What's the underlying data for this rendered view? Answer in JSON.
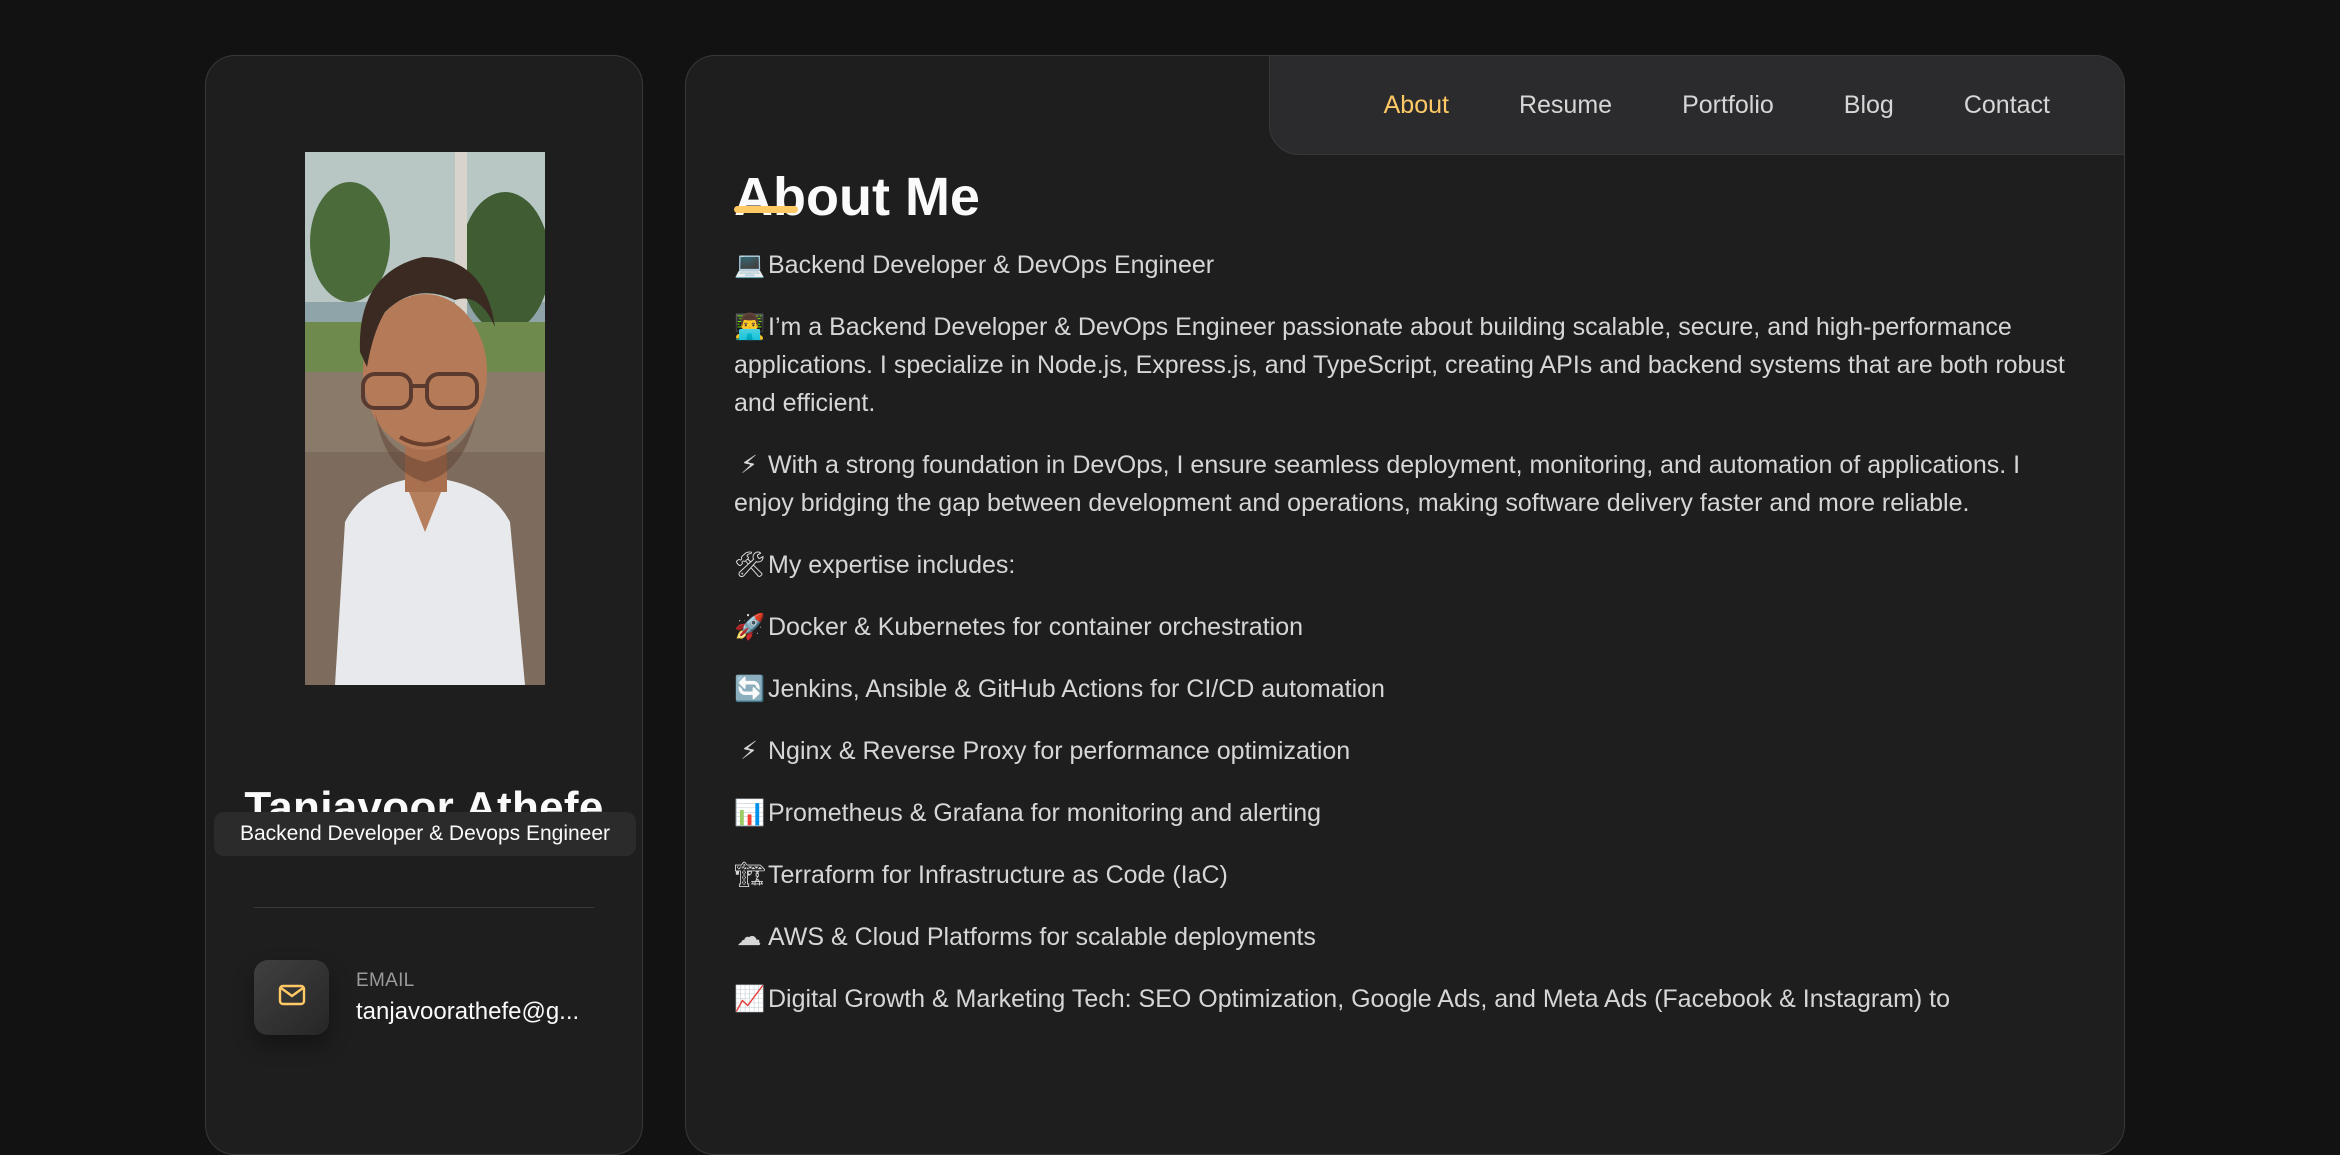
{
  "sidebar": {
    "name": "Tanjavoor Athefe",
    "title": "Backend Developer & Devops Engineer",
    "contact": {
      "icon": "mail-icon",
      "label": "EMAIL",
      "value": "tanjavoorathefe@g..."
    }
  },
  "navbar": {
    "items": [
      "About",
      "Resume",
      "Portfolio",
      "Blog",
      "Contact"
    ],
    "active": "About"
  },
  "article": {
    "title": "About Me",
    "paragraphs": [
      {
        "emoji": "💻",
        "text": "Backend Developer & DevOps Engineer"
      },
      {
        "emoji": "👨‍💻",
        "text": "I’m a Backend Developer & DevOps Engineer passionate about building scalable, secure, and high-performance applications. I specialize in Node.js, Express.js, and TypeScript, creating APIs and backend systems that are both robust and efficient."
      },
      {
        "emoji": "⚡",
        "text": "With a strong foundation in DevOps, I ensure seamless deployment, monitoring, and automation of applications. I enjoy bridging the gap between development and operations, making software delivery faster and more reliable."
      },
      {
        "emoji": "🛠",
        "text": "My expertise includes:"
      },
      {
        "emoji": "🚀",
        "text": "Docker & Kubernetes for container orchestration"
      },
      {
        "emoji": "🔄",
        "text": "Jenkins, Ansible & GitHub Actions for CI/CD automation"
      },
      {
        "emoji": "⚡",
        "text": "Nginx & Reverse Proxy for performance optimization"
      },
      {
        "emoji": "📊",
        "text": "Prometheus & Grafana for monitoring and alerting"
      },
      {
        "emoji": "🏗",
        "text": "Terraform for Infrastructure as Code (IaC)"
      },
      {
        "emoji": "☁",
        "text": "AWS & Cloud Platforms for scalable deployments"
      },
      {
        "emoji": "📈",
        "text": "Digital Growth & Marketing Tech: SEO Optimization, Google Ads, and Meta Ads (Facebook & Instagram) to"
      }
    ]
  },
  "colors": {
    "accent": "#ffc965",
    "background": "#121212",
    "panel": "#1e1e1f",
    "border": "#383838"
  }
}
